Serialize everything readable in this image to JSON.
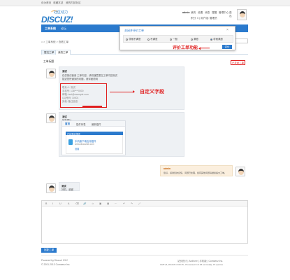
{
  "topbar": {
    "left": "设为首页",
    "fav": "收藏本站",
    "mobile": "我的内部社区"
  },
  "logo": {
    "main": "DISCUZ!",
    "sub": "社区动力"
  },
  "user": {
    "name": "admin",
    "links": [
      "我的",
      "设置",
      "消息",
      "提醒",
      "管理中心",
      "退出"
    ],
    "row2": "积分: 0 | 用户组: 管理员"
  },
  "nav": {
    "items": [
      "工单系统",
      "论坛"
    ]
  },
  "popup": {
    "title": "关闭并评价工单",
    "close": "×",
    "options": [
      "非常不满意",
      "不满意",
      "一般",
      "满意",
      "非常满意"
    ],
    "selected": 4,
    "submit": "评价"
  },
  "annotations": {
    "rating": "评价工单功能",
    "custom_fields": "自定义字段"
  },
  "breadcrumb": "⌂  >  工单系统  >  查看工单",
  "tabs": [
    "提交工单",
    "我的工单"
  ],
  "ticket_title": "工单标题",
  "status_badge": "已关闭工单",
  "messages": [
    {
      "author": "测试",
      "text1": "仅供测试使用 工单内容，请勿随意提交工单内容测试",
      "text2": "描述您所遇到的问题，请详细说明",
      "fields": [
        "联系人: 测试",
        "手机号: 138****0000",
        "邮箱: test@example.com",
        "QQ号码: 10001",
        "其他: 备注信息"
      ]
    },
    {
      "author": "测试",
      "text": "回复图片",
      "card_tabs": [
        "首页",
        "插件列表",
        "最新插件"
      ],
      "card_title": "已经购买插件",
      "card_item": "手机客户端应用插件",
      "card_sub": "www.discuzlab.com",
      "card_action": "设置"
    },
    {
      "author": "admin",
      "text": "您好，感谢您的反馈，问题已处理，如有其他问题请继续提交工单。"
    },
    {
      "author": "测试",
      "text": "好的，谢谢"
    }
  ],
  "editor_tools": [
    "B",
    "I",
    "U",
    "A",
    "⌫",
    "🔗",
    "☺",
    "▣",
    "▤",
    "⋯",
    "↶",
    "↷",
    "⤢"
  ],
  "send_label": "回复工单",
  "footer": {
    "powered": "Powered by Discuz! X3.2",
    "copy": "© 2001-2013 Comsenz Inc.",
    "links": "站长统计 | Archiver | 手机版 | Comsenz Inc.",
    "meta": "GMT+8, 2014-8-13 09:15 , Processed in 0.06 second(s), 15 queries ."
  },
  "colors": {
    "primary": "#2b7acd",
    "annotation": "#e02020"
  }
}
